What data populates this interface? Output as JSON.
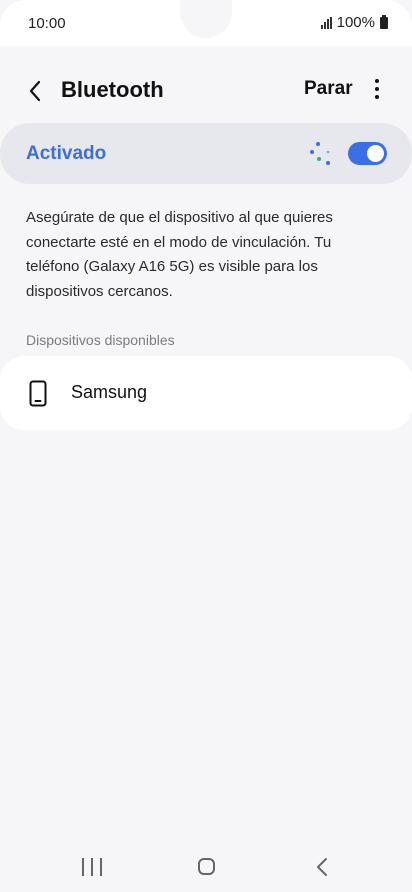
{
  "status_bar": {
    "time": "10:00",
    "battery": "100%",
    "icons": [
      "signal-icon",
      "battery-icon"
    ]
  },
  "header": {
    "title": "Bluetooth",
    "stop_label": "Parar",
    "back_icon": "chevron-left-icon",
    "more_icon": "more-vertical-icon"
  },
  "bluetooth_toggle": {
    "label": "Activado",
    "state": true,
    "scanning": true,
    "accent_color": "#3b6fe6"
  },
  "description": "Asegúrate de que el dispositivo al que quieres conectarte esté en el modo de vinculación. Tu teléfono (Galaxy A16 5G) es visible para los dispositivos cercanos.",
  "available_devices": {
    "section_label": "Dispositivos disponibles",
    "items": [
      {
        "name": "Samsung",
        "icon": "phone-icon"
      }
    ]
  },
  "nav_bar": {
    "icons": [
      "recents-icon",
      "home-icon",
      "back-icon"
    ]
  }
}
